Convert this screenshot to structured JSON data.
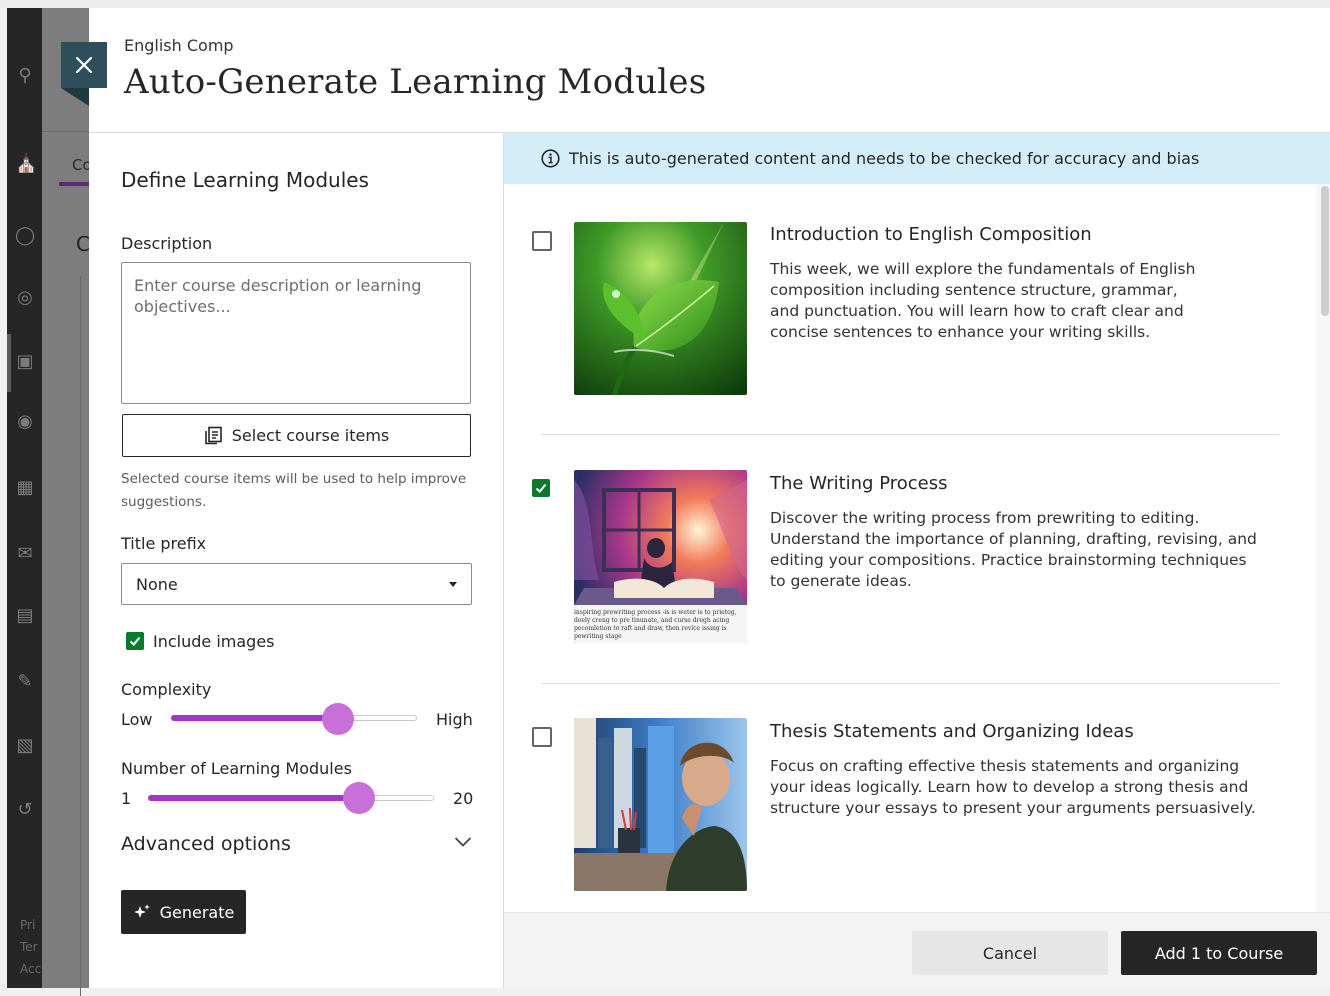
{
  "background": {
    "nav_icons": [
      "search-icon",
      "institution-icon",
      "user-icon",
      "globe-icon",
      "courses-icon",
      "groups-icon",
      "calendar-icon",
      "mail-icon",
      "grades-icon",
      "tools-icon",
      "edit-icon",
      "signout-icon"
    ],
    "tab_label": "Co",
    "heading_partial": "C",
    "footer_links": [
      "Pri",
      "Ter",
      "Acc"
    ]
  },
  "header": {
    "course_name": "English Comp",
    "title": "Auto-Generate Learning Modules",
    "close_label": "Close"
  },
  "form": {
    "section_title": "Define Learning Modules",
    "description_label": "Description",
    "description_value": "",
    "description_placeholder": "Enter course description or learning objectives...",
    "select_items_label": "Select course items",
    "select_items_hint": "Selected course items will be used to help improve suggestions.",
    "title_prefix_label": "Title prefix",
    "title_prefix_value": "None",
    "include_images_label": "Include images",
    "include_images_checked": true,
    "complexity_label": "Complexity",
    "complexity_low": "Low",
    "complexity_high": "High",
    "complexity_level": 0.68,
    "num_modules_label": "Number of Learning Modules",
    "num_modules_min": "1",
    "num_modules_max": "20",
    "num_modules_value": 15,
    "advanced_label": "Advanced options",
    "generate_label": "Generate"
  },
  "banner": {
    "text": "This is auto-generated content and needs to be checked for accuracy and bias"
  },
  "modules": [
    {
      "title": "Introduction to English Composition",
      "description": "This week, we will explore the fundamentals of English composition including sentence structure, grammar, and punctuation. You will learn how to craft clear and concise sentences to enhance your writing skills.",
      "checked": false
    },
    {
      "title": "The Writing Process",
      "description": "Discover the writing process from prewriting to editing. Understand the importance of planning, drafting, revising, and editing your compositions. Practice brainstorming techniques to generate ideas.",
      "checked": true,
      "image_caption": "inspiring prewriting process -is is weter is to prietog, deely creng to pre tinunate, and curse dregh acing pecomletion to raft and draw, then revice issing is pewriting stage"
    },
    {
      "title": "Thesis Statements and Organizing Ideas",
      "description": "Focus on crafting effective thesis statements and organizing your ideas logically. Learn how to develop a strong thesis and structure your essays to present your arguments persuasively.",
      "checked": false
    }
  ],
  "footer": {
    "cancel_label": "Cancel",
    "add_label": "Add 1 to Course"
  },
  "colors": {
    "accent_purple": "#a335c7",
    "thumb_purple": "#c86fd9",
    "check_green": "#0b7a2c",
    "banner_blue": "#d3eef9",
    "dark": "#262626",
    "close_teal": "#2f4e5b"
  }
}
